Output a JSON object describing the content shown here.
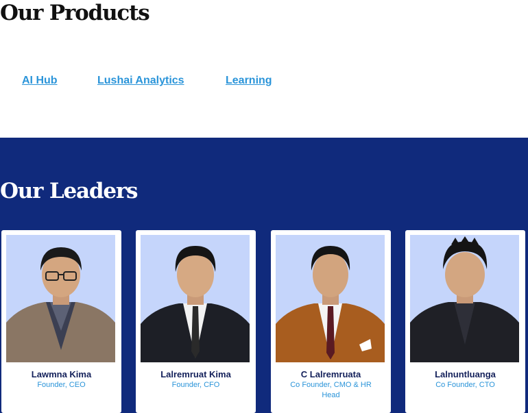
{
  "products": {
    "heading": "Our Products",
    "links": [
      {
        "label": "AI Hub"
      },
      {
        "label": "Lushai Analytics"
      },
      {
        "label": "Learning"
      }
    ]
  },
  "leaders": {
    "heading": "Our Leaders",
    "people": [
      {
        "name": "Lawmna Kima",
        "role": "Founder, CEO"
      },
      {
        "name": "Lalremruat Kima",
        "role": "Founder, CFO"
      },
      {
        "name": "C Lalremruata",
        "role": "Co Founder, CMO & HR Head"
      },
      {
        "name": "Lalnuntluanga",
        "role": "Co Founder, CTO"
      }
    ]
  },
  "colors": {
    "link": "#2a94d9",
    "section_bg": "#102a7c",
    "photo_bg": "#c5d5fb",
    "name_text": "#13205a"
  }
}
